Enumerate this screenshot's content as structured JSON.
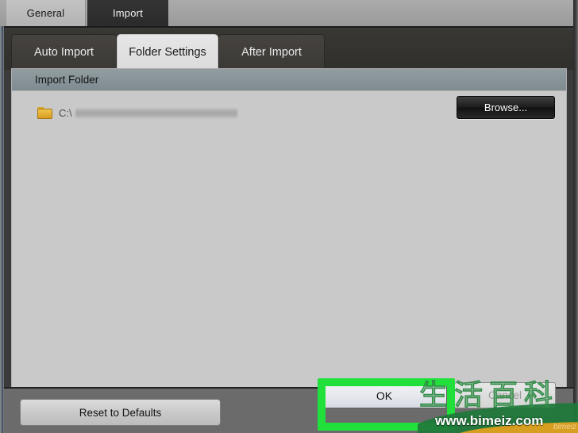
{
  "window": {
    "top_tabs": [
      {
        "label": "General",
        "active": false
      },
      {
        "label": "Import",
        "active": true
      }
    ]
  },
  "sub_tabs": [
    {
      "label": "Auto Import",
      "active": false
    },
    {
      "label": "Folder Settings",
      "active": true
    },
    {
      "label": "After Import",
      "active": false
    }
  ],
  "content": {
    "section_title": "Import Folder",
    "folder": {
      "icon": "folder-icon",
      "path_prefix": "C:\\",
      "path_redacted": true
    },
    "browse_label": "Browse..."
  },
  "footer": {
    "reset_label": "Reset to Defaults",
    "ok_label": "OK",
    "cancel_label": "Cancel"
  },
  "annotation": {
    "highlight_color": "#22e03c",
    "target": "ok-button"
  },
  "watermark": {
    "characters": "生活百科",
    "url": "www.bimeiz.com",
    "sub_text": "bimeiz",
    "colors": {
      "stroke": "#2e8b45",
      "swoosh_dark": "#1f7a3a",
      "swoosh_gold": "#e8a21c"
    }
  }
}
